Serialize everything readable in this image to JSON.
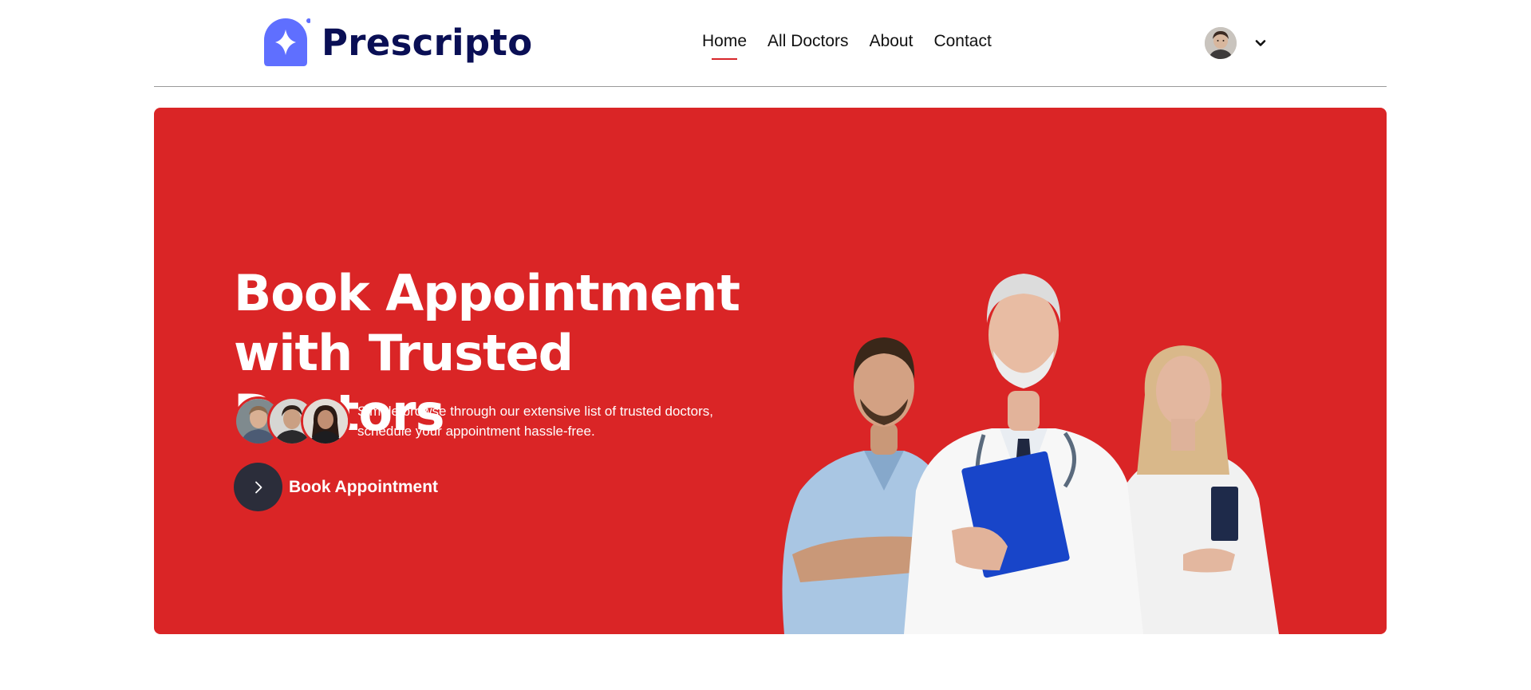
{
  "brand": {
    "name": "Prescripto",
    "accent": "#5f6fff",
    "text_color": "#0a0f55"
  },
  "nav": {
    "items": [
      {
        "label": "Home",
        "active": true
      },
      {
        "label": "All Doctors",
        "active": false
      },
      {
        "label": "About",
        "active": false
      },
      {
        "label": "Contact",
        "active": false
      }
    ]
  },
  "profile": {
    "avatar_icon": "user-avatar",
    "dropdown_icon": "chevron-down-icon"
  },
  "hero": {
    "background": "#da2526",
    "title_line1": "Book Appointment",
    "title_line2": "with Trusted Doctors",
    "desc_line1": "Simple browse through our extensive list of trusted doctors,",
    "desc_line2": "schedule your appointment hassle-free.",
    "cta_label": "Book Appointment",
    "cta_icon": "chevron-right-icon"
  }
}
